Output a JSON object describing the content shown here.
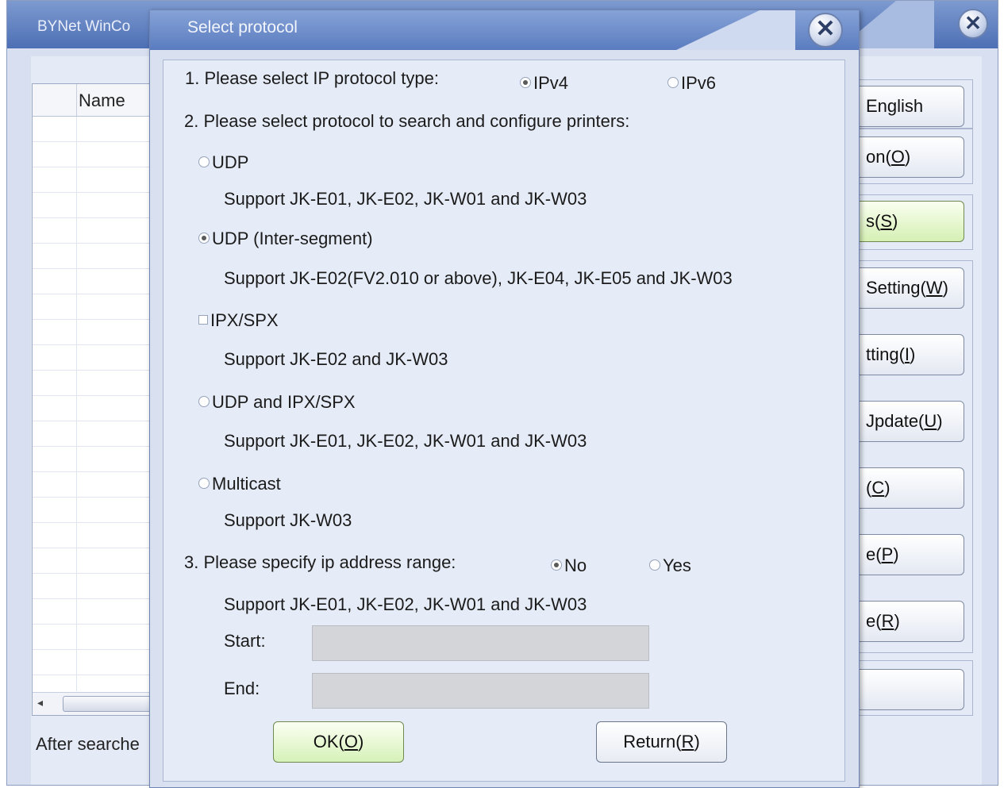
{
  "main_window": {
    "title": "BYNet WinCo",
    "close_glyph": "✕",
    "list_header": "Name",
    "status_text": "After searche",
    "side_buttons": [
      {
        "label": "English",
        "mnemonic": ""
      },
      {
        "label": "on(",
        "mnemonic": "O",
        "suffix": ")"
      },
      {
        "label": "s(",
        "mnemonic": "S",
        "suffix": ")"
      },
      {
        "label": "Setting(",
        "mnemonic": "W",
        "suffix": ")"
      },
      {
        "label": "tting(",
        "mnemonic": "I",
        "suffix": ")"
      },
      {
        "label": "Jpdate(",
        "mnemonic": "U",
        "suffix": ")"
      },
      {
        "label": "(",
        "mnemonic": "C",
        "suffix": ")"
      },
      {
        "label": "e(",
        "mnemonic": "P",
        "suffix": ")"
      },
      {
        "label": "e(",
        "mnemonic": "R",
        "suffix": ")"
      },
      {
        "label": "",
        "mnemonic": "",
        "suffix": ""
      }
    ]
  },
  "dialog": {
    "title": "Select protocol",
    "close_glyph": "✕",
    "step1": {
      "label": "1. Please select IP protocol type:",
      "options": [
        {
          "label": "IPv4",
          "selected": true
        },
        {
          "label": "IPv6",
          "selected": false
        }
      ]
    },
    "step2": {
      "label": "2. Please select protocol to search and configure printers:"
    },
    "protocols": [
      {
        "label": "UDP",
        "control": "radio",
        "selected": false,
        "support": "Support JK-E01, JK-E02, JK-W01 and JK-W03"
      },
      {
        "label": "UDP (Inter-segment)",
        "control": "radio",
        "selected": true,
        "support": "Support JK-E02(FV2.010 or above), JK-E04, JK-E05 and JK-W03"
      },
      {
        "label": "IPX/SPX",
        "control": "checkbox",
        "selected": false,
        "support": "Support JK-E02 and JK-W03"
      },
      {
        "label": "UDP and IPX/SPX",
        "control": "radio",
        "selected": false,
        "support": "Support JK-E01, JK-E02, JK-W01 and JK-W03"
      },
      {
        "label": "Multicast",
        "control": "radio",
        "selected": false,
        "support": "Support JK-W03"
      }
    ],
    "step3": {
      "label": "3. Please specify ip address range:",
      "options": [
        {
          "label": "No",
          "selected": true
        },
        {
          "label": "Yes",
          "selected": false
        }
      ],
      "support": "Support JK-E01, JK-E02, JK-W01 and JK-W03"
    },
    "start_label": "Start:",
    "start_value": "",
    "end_label": "End:",
    "end_value": "",
    "ok_button": {
      "label": "OK(",
      "mnemonic": "O",
      "suffix": ")"
    },
    "return_button": {
      "label": "Return(",
      "mnemonic": "R",
      "suffix": ")"
    }
  }
}
